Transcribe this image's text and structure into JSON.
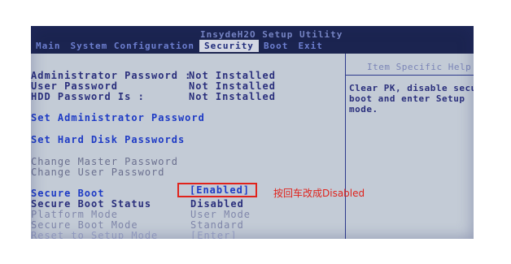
{
  "app": {
    "title": "InsydeH2O Setup Utility"
  },
  "tabs": [
    {
      "label": "Main",
      "active": false
    },
    {
      "label": "System Configuration",
      "active": false
    },
    {
      "label": "Security",
      "active": true
    },
    {
      "label": "Boot",
      "active": false
    },
    {
      "label": "Exit",
      "active": false
    }
  ],
  "passwords": [
    {
      "label": "Administrator Password :",
      "value": "Not Installed"
    },
    {
      "label": "User Password",
      "value": "Not Installed"
    },
    {
      "label": "HDD Password Is :",
      "value": "Not Installed"
    }
  ],
  "actions": {
    "set_admin": "Set Administrator Password",
    "set_hdd": "Set Hard Disk Passwords",
    "change_master": "Change Master Password",
    "change_user": "Change User Password"
  },
  "secure_boot": {
    "label": "Secure Boot",
    "value": "[Enabled]",
    "status_label": "Secure Boot Status",
    "status_value": "Disabled",
    "platform_label": "Platform Mode",
    "platform_value": "User Mode",
    "mode_label": "Secure Boot Mode",
    "mode_value": "Standard",
    "reset_label": "Reset to Setup Mode",
    "reset_value": "[Enter]"
  },
  "help": {
    "header": "Item Specific Help",
    "lines": [
      "Clear PK, disable secure",
      "boot and enter Setup",
      "mode."
    ]
  },
  "annotation": "按回车改成Disabled",
  "colors": {
    "screen_bg": "#c3cbd6",
    "title_bar": "#1b2450",
    "link": "#1d3ac5",
    "annotation_red": "#e0231c"
  }
}
